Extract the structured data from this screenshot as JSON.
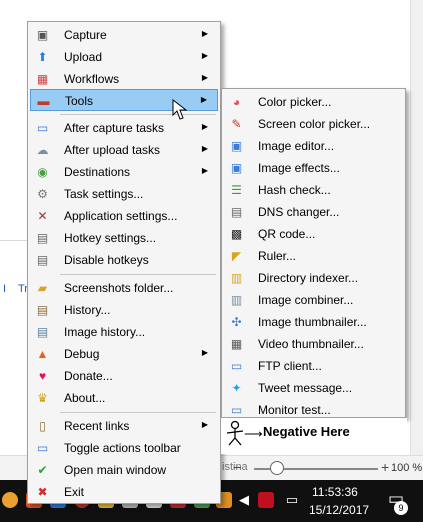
{
  "main_menu": {
    "items": [
      {
        "label": "Capture",
        "icon": "camera-icon",
        "submenu": true
      },
      {
        "label": "Upload",
        "icon": "upload-arrow-icon",
        "submenu": true
      },
      {
        "label": "Workflows",
        "icon": "grid-icon",
        "submenu": true
      },
      {
        "label": "Tools",
        "icon": "toolbox-icon",
        "submenu": true
      },
      {
        "label": "After capture tasks",
        "icon": "after-capture-icon",
        "submenu": true
      },
      {
        "label": "After upload tasks",
        "icon": "cloud-icon",
        "submenu": true
      },
      {
        "label": "Destinations",
        "icon": "globe-icon",
        "submenu": true
      },
      {
        "label": "Task settings...",
        "icon": "gear-icon",
        "submenu": false
      },
      {
        "label": "Application settings...",
        "icon": "wrench-screwdriver-icon",
        "submenu": false
      },
      {
        "label": "Hotkey settings...",
        "icon": "keyboard-icon",
        "submenu": false
      },
      {
        "label": "Disable hotkeys",
        "icon": "keyboard-disabled-icon",
        "submenu": false
      },
      {
        "label": "Screenshots folder...",
        "icon": "folder-icon",
        "submenu": false
      },
      {
        "label": "History...",
        "icon": "history-icon",
        "submenu": false
      },
      {
        "label": "Image history...",
        "icon": "image-history-icon",
        "submenu": false
      },
      {
        "label": "Debug",
        "icon": "traffic-cone-icon",
        "submenu": true
      },
      {
        "label": "Donate...",
        "icon": "heart-icon",
        "submenu": false
      },
      {
        "label": "About...",
        "icon": "crown-icon",
        "submenu": false
      },
      {
        "label": "Recent links",
        "icon": "clipboard-icon",
        "submenu": true
      },
      {
        "label": "Toggle actions toolbar",
        "icon": "toolbar-icon",
        "submenu": false
      },
      {
        "label": "Open main window",
        "icon": "checkmark-icon",
        "submenu": false
      },
      {
        "label": "Exit",
        "icon": "exit-x-icon",
        "submenu": false
      }
    ]
  },
  "tools_menu": {
    "items": [
      {
        "label": "Color picker...",
        "icon": "color-wheel-icon"
      },
      {
        "label": "Screen color picker...",
        "icon": "eyedropper-icon"
      },
      {
        "label": "Image editor...",
        "icon": "image-editor-icon"
      },
      {
        "label": "Image effects...",
        "icon": "image-effects-icon"
      },
      {
        "label": "Hash check...",
        "icon": "hash-check-icon"
      },
      {
        "label": "DNS changer...",
        "icon": "dns-icon"
      },
      {
        "label": "QR code...",
        "icon": "qr-code-icon"
      },
      {
        "label": "Ruler...",
        "icon": "ruler-icon"
      },
      {
        "label": "Directory indexer...",
        "icon": "directory-icon"
      },
      {
        "label": "Image combiner...",
        "icon": "image-combiner-icon"
      },
      {
        "label": "Image thumbnailer...",
        "icon": "image-thumbnailer-icon"
      },
      {
        "label": "Video thumbnailer...",
        "icon": "video-thumbnailer-icon"
      },
      {
        "label": "FTP client...",
        "icon": "ftp-icon"
      },
      {
        "label": "Tweet message...",
        "icon": "twitter-bird-icon"
      },
      {
        "label": "Monitor test...",
        "icon": "monitor-icon"
      }
    ]
  },
  "annotation": {
    "label": "Negative Here"
  },
  "background": {
    "link_text": "Tr",
    "status_text": "istina"
  },
  "statusbar": {
    "zoom_minus": "−",
    "zoom_plus": "+",
    "zoom_level": "100 %",
    "zoom_fraction": 0.13
  },
  "taskbar": {
    "time": "11:53:36",
    "date": "15/12/2017",
    "notification_count": "9"
  },
  "colors": {
    "menu_bg": "#f5f5f5",
    "highlight": "#99ccf5",
    "highlight_border": "#5b9bd5",
    "taskbar": "#101010"
  }
}
